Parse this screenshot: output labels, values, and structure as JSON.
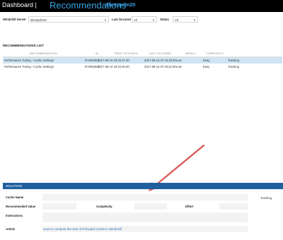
{
  "header": {
    "dashboard_label": "Dashboard |",
    "title": "Recommendations",
    "server_name": "kbntspdm20"
  },
  "filters": {
    "server_label": "Windchill Server",
    "server_value": "kbntspdm20",
    "last_label": "Last Occured",
    "last_value": "All",
    "status_label": "Status",
    "status_value": "All"
  },
  "recommendations": {
    "section_title": "RECOMMENDATIONS LIST",
    "columns": [
      "RECOMMENDATION",
      "ID",
      "FIRST OCCURED",
      "LAST OCCURED",
      "IMPACT",
      "COMPLEXITY"
    ],
    "rows": [
      {
        "recommendation": "Performance Tuning - Cache Settings",
        "id": "R-0053021",
        "first": "2017-08-10 19:22:27.00",
        "last": "2017-08-12 07:19:18.00",
        "impact": "Low",
        "complexity": "Easy",
        "status": "Tracking"
      },
      {
        "recommendation": "Performance Tuning - Cache Settings",
        "id": "R-0053022",
        "first": "2017-08-10 19:22:40.00",
        "last": "2017-08-12 07:19:22.00",
        "impact": "Low",
        "complexity": "Easy",
        "status": "Tracking"
      }
    ]
  },
  "solution": {
    "section_title": "SOLUTION",
    "cache_name_label": "Cache Name",
    "status_value": "Tracking",
    "recommended_value_label": "Recommended Value",
    "complexity_label": "Complexity",
    "effort_label": "Effort",
    "instructions_label": "Instructions",
    "article_label": "Article",
    "article_link": "How to compute the size of Principal Cache in Windchill"
  },
  "colors": {
    "header_bg": "#000000",
    "accent": "#3aa3e3",
    "selected_row": "#cfe4f2",
    "solution_bar": "#1f5f9e",
    "annotation_arrow": "#d9534f"
  }
}
